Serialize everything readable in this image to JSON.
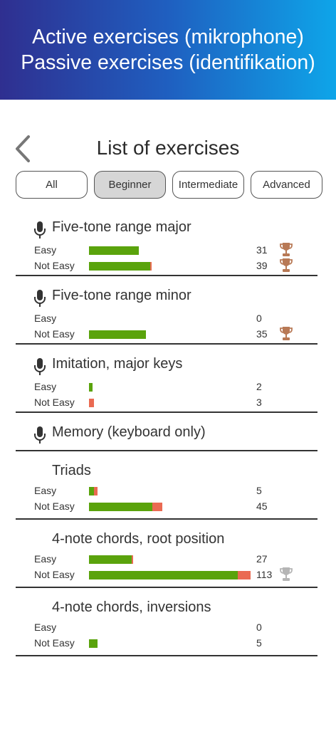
{
  "banner": {
    "line1": "Active exercises (mikrophone)",
    "line2": "Passive exercises (identifikation)"
  },
  "header": {
    "title": "List of exercises"
  },
  "filters": [
    {
      "label": "All",
      "active": false
    },
    {
      "label": "Beginner",
      "active": true
    },
    {
      "label": "Intermediate",
      "active": false
    },
    {
      "label": "Advanced",
      "active": false
    }
  ],
  "colors": {
    "bar_green": "#5aa30c",
    "bar_red": "#ea6a52",
    "trophy_bronze": "#b87955",
    "trophy_silver": "#b5b5b5"
  },
  "exercises": [
    {
      "title": "Five-tone range major",
      "icon": "microphone-icon",
      "rows": [
        {
          "label": "Easy",
          "count": "31",
          "trophy": "bronze-trophy-icon"
        },
        {
          "label": "Not Easy",
          "count": "39",
          "trophy": "bronze-trophy-icon"
        }
      ]
    },
    {
      "title": "Five-tone range minor",
      "icon": "microphone-icon",
      "rows": [
        {
          "label": "Easy",
          "count": "0"
        },
        {
          "label": "Not Easy",
          "count": "35",
          "trophy": "bronze-trophy-icon"
        }
      ]
    },
    {
      "title": "Imitation, major keys",
      "icon": "microphone-icon",
      "rows": [
        {
          "label": "Easy",
          "count": "2"
        },
        {
          "label": "Not Easy",
          "count": "3"
        }
      ]
    },
    {
      "title": "Memory (keyboard only)",
      "icon": "microphone-icon",
      "rows": []
    },
    {
      "title": "Triads",
      "rows": [
        {
          "label": "Easy",
          "count": "5"
        },
        {
          "label": "Not Easy",
          "count": "45"
        }
      ]
    },
    {
      "title": "4-note chords, root position",
      "rows": [
        {
          "label": "Easy",
          "count": "27"
        },
        {
          "label": "Not Easy",
          "count": "113",
          "trophy": "silver-trophy-icon"
        }
      ]
    },
    {
      "title": "4-note chords, inversions",
      "rows": [
        {
          "label": "Easy",
          "count": "0"
        },
        {
          "label": "Not Easy",
          "count": "5"
        }
      ]
    }
  ]
}
